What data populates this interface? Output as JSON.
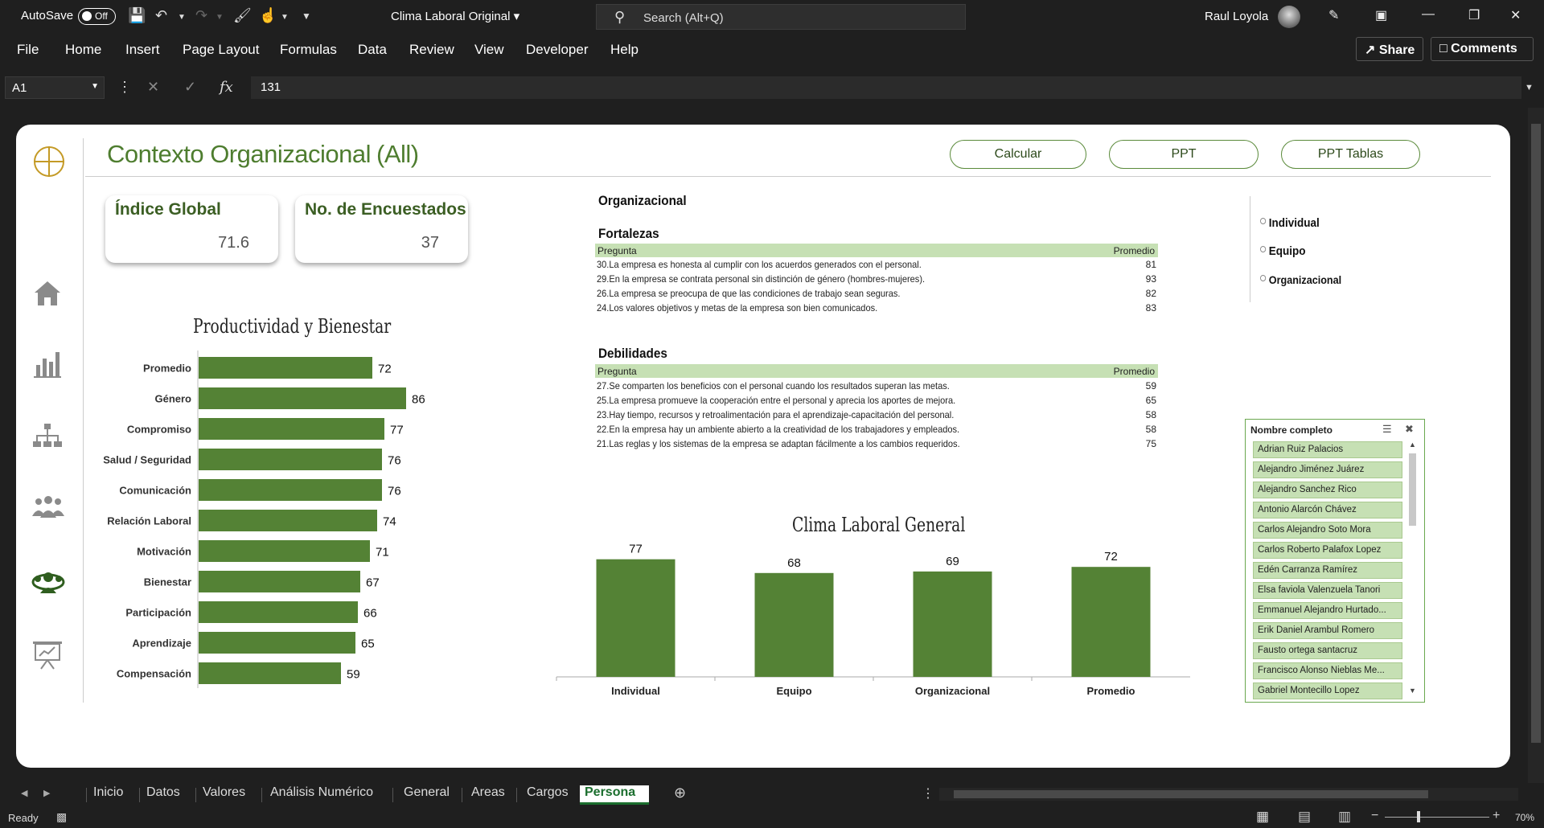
{
  "titlebar": {
    "autosave_label": "AutoSave",
    "autosave_state": "Off",
    "doc_title": "Clima Laboral Original",
    "search_placeholder": "Search (Alt+Q)",
    "user_name": "Raul Loyola"
  },
  "menu": {
    "items": [
      "File",
      "Home",
      "Insert",
      "Page Layout",
      "Formulas",
      "Data",
      "Review",
      "View",
      "Developer",
      "Help"
    ],
    "share": "Share",
    "comments": "Comments"
  },
  "formula_bar": {
    "cell_ref": "A1",
    "value": "131"
  },
  "dashboard": {
    "title": "Contexto Organizacional",
    "filter": "(All)",
    "buttons": [
      "Calcular",
      "PPT",
      "PPT Tablas"
    ],
    "kpis": [
      {
        "label": "Índice Global",
        "value": "71.6"
      },
      {
        "label": "No. de Encuestados",
        "value": "37"
      }
    ],
    "section_title": "Organizacional",
    "fortalezas": {
      "title": "Fortalezas",
      "col_question": "Pregunta",
      "col_avg": "Promedio",
      "rows": [
        {
          "q": "30.La empresa es honesta al cumplir con los acuerdos generados con el personal.",
          "v": "81"
        },
        {
          "q": "29.En la empresa se contrata personal sin distinción de género (hombres-mujeres).",
          "v": "93"
        },
        {
          "q": "26.La empresa se preocupa de que las condiciones de trabajo sean seguras.",
          "v": "82"
        },
        {
          "q": "24.Los valores objetivos y metas de la empresa son bien comunicados.",
          "v": "83"
        }
      ]
    },
    "debilidades": {
      "title": "Debilidades",
      "col_question": "Pregunta",
      "col_avg": "Promedio",
      "rows": [
        {
          "q": "27.Se comparten los beneficios con el personal cuando los resultados superan las metas.",
          "v": "59"
        },
        {
          "q": "25.La empresa promueve la cooperación entre el personal y aprecia los aportes de mejora.",
          "v": "65"
        },
        {
          "q": "23.Hay tiempo, recursos y retroalimentación para el aprendizaje-capacitación del personal.",
          "v": "58"
        },
        {
          "q": "22.En la empresa hay un ambiente abierto a la creatividad de los trabajadores y empleados.",
          "v": "58"
        },
        {
          "q": "21.Las reglas y los sistemas de la empresa se adaptan fácilmente a los cambios requeridos.",
          "v": "75"
        }
      ]
    },
    "radio_options": [
      "Individual",
      "Equipo",
      "Organizacional"
    ],
    "slicer": {
      "title": "Nombre completo",
      "items": [
        "Adrian Ruiz Palacios",
        "Alejandro Jiménez Juárez",
        "Alejandro Sanchez Rico",
        "Antonio Alarcón Chávez",
        "Carlos Alejandro Soto Mora",
        "Carlos Roberto Palafox Lopez",
        "Edén Carranza Ramírez",
        "Elsa faviola Valenzuela Tanori",
        "Emmanuel Alejandro Hurtado...",
        "Erik Daniel Arambul Romero",
        "Fausto ortega santacruz",
        "Francisco Alonso Nieblas Me...",
        "Gabriel Montecillo Lopez"
      ]
    },
    "sidebar_icons": [
      "home-icon",
      "bar-chart-icon",
      "org-chart-icon",
      "group-icon",
      "team-icon",
      "presentation-icon"
    ],
    "bar_color": "#548235"
  },
  "chart_data": [
    {
      "type": "bar",
      "orientation": "horizontal",
      "title": "Productividad y Bienestar",
      "categories": [
        "Promedio",
        "Género",
        "Compromiso",
        "Salud / Seguridad",
        "Comunicación",
        "Relación Laboral",
        "Motivación",
        "Bienestar",
        "Participación",
        "Aprendizaje",
        "Compensación"
      ],
      "values": [
        72,
        86,
        77,
        76,
        76,
        74,
        71,
        67,
        66,
        65,
        59
      ],
      "data_labels": true,
      "color": "#548235"
    },
    {
      "type": "bar",
      "orientation": "vertical",
      "title": "Clima Laboral General",
      "categories": [
        "Individual",
        "Equipo",
        "Organizacional",
        "Promedio"
      ],
      "values": [
        77,
        68,
        69,
        72
      ],
      "data_labels": true,
      "color": "#548235"
    }
  ],
  "tabs": {
    "items": [
      "Inicio",
      "Datos",
      "Valores",
      "Análisis Numérico",
      "General",
      "Areas",
      "Cargos",
      "Persona"
    ],
    "active": "Persona"
  },
  "status": {
    "ready": "Ready",
    "zoom": "70%"
  }
}
